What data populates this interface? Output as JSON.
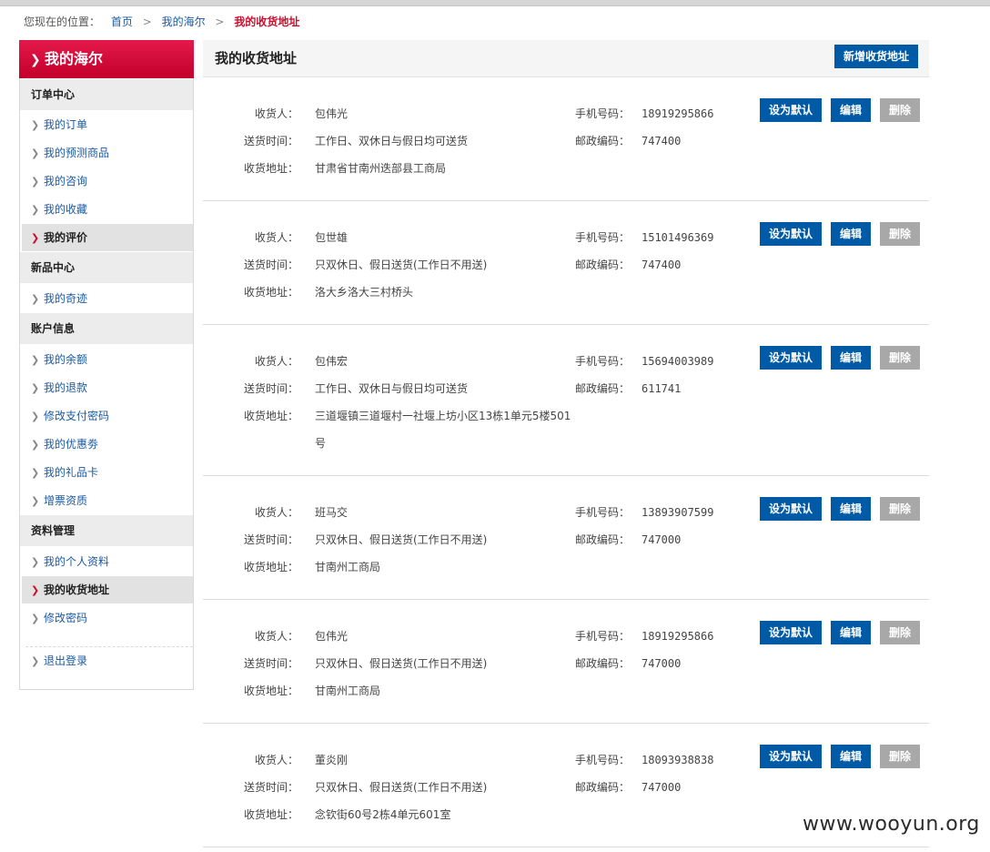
{
  "breadcrumb": {
    "prefix": "您现在的位置：",
    "items": [
      "首页",
      "我的海尔"
    ],
    "current": "我的收货地址",
    "separator": ">"
  },
  "sidebar": {
    "title": "我的海尔",
    "sections": [
      {
        "title": "订单中心",
        "items": [
          "我的订单",
          "我的预测商品",
          "我的咨询",
          "我的收藏",
          "我的评价"
        ]
      },
      {
        "title": "新品中心",
        "items": [
          "我的奇迹"
        ]
      },
      {
        "title": "账户信息",
        "items": [
          "我的余额",
          "我的退款",
          "修改支付密码",
          "我的优惠劵",
          "我的礼品卡",
          "增票资质"
        ]
      },
      {
        "title": "资料管理",
        "items": [
          "我的个人资料",
          "我的收货地址",
          "修改密码"
        ]
      }
    ],
    "logout": "退出登录",
    "active_items": [
      "我的评价",
      "我的收货地址"
    ]
  },
  "main": {
    "title": "我的收货地址",
    "add_button": "新增收货地址",
    "labels": {
      "receiver": "收货人：",
      "delivery_time": "送货时间：",
      "address": "收货地址：",
      "phone": "手机号码：",
      "postcode": "邮政编码："
    },
    "buttons": {
      "set_default": "设为默认",
      "edit": "编辑",
      "delete": "删除"
    },
    "addresses": [
      {
        "receiver": "包伟光",
        "delivery_time": "工作日、双休日与假日均可送货",
        "address": "甘肃省甘南州迭部县工商局",
        "phone": "18919295866",
        "postcode": "747400"
      },
      {
        "receiver": "包世雄",
        "delivery_time": "只双休日、假日送货(工作日不用送)",
        "address": "洛大乡洛大三村桥头",
        "phone": "15101496369",
        "postcode": "747400"
      },
      {
        "receiver": "包伟宏",
        "delivery_time": "工作日、双休日与假日均可送货",
        "address": "三道堰镇三道堰村一社堰上坊小区13栋1单元5楼501号",
        "phone": "15694003989",
        "postcode": "611741"
      },
      {
        "receiver": "班马交",
        "delivery_time": "只双休日、假日送货(工作日不用送)",
        "address": "甘南州工商局",
        "phone": "13893907599",
        "postcode": "747000"
      },
      {
        "receiver": "包伟光",
        "delivery_time": "只双休日、假日送货(工作日不用送)",
        "address": "甘南州工商局",
        "phone": "18919295866",
        "postcode": "747000"
      },
      {
        "receiver": "董炎刚",
        "delivery_time": "只双休日、假日送货(工作日不用送)",
        "address": "念钦街60号2栋4单元601室",
        "phone": "18093938838",
        "postcode": "747000"
      }
    ]
  },
  "watermark": "www.wooyun.org",
  "colors": {
    "brand_red": "#c8102e",
    "button_blue": "#005aa6",
    "button_gray": "#a8a8a8",
    "link_blue": "#1b5aa3"
  }
}
